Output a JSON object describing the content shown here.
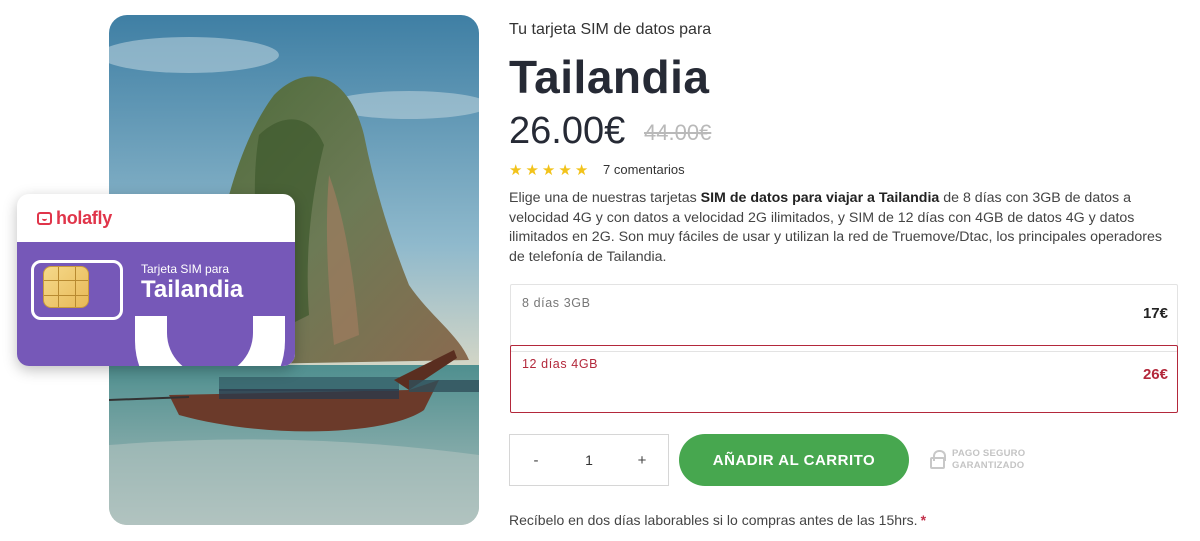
{
  "product": {
    "subtitle": "Tu tarjeta SIM de datos para",
    "title": "Tailandia",
    "price": "26.00€",
    "old_price": "44.00€",
    "rating": 5,
    "reviews": "7 comentarios",
    "description": {
      "p1": "Elige una de nuestras tarjetas ",
      "b1": "SIM de datos para viajar a Tailandia",
      "p2": " de 8 días con 3GB de datos a velocidad 4G y con datos a velocidad 2G ilimitados, y SIM de 12 días con 4GB de datos 4G y datos ilimitados en 2G. Son muy fáciles de usar y utilizan la red de Truemove/Dtac, los principales operadores de telefonía de Tailandia."
    }
  },
  "sim_card": {
    "brand": "holafly",
    "small_text": "Tarjeta SIM para",
    "big_text": "Tailandia"
  },
  "options": [
    {
      "label": "8 días 3GB",
      "price": "17€",
      "selected": false
    },
    {
      "label": "12 días 4GB",
      "price": "26€",
      "selected": true
    }
  ],
  "quantity": {
    "minus": "-",
    "value": "1",
    "plus": "+"
  },
  "cart_button": "AÑADIR AL CARRITO",
  "secure": {
    "line1": "PAGO SEGURO",
    "line2": "GARANTIZADO"
  },
  "delivery": {
    "text": "Recíbelo en dos días laborables si lo compras antes de las 15hrs.",
    "asterisk": "*"
  },
  "colors": {
    "accent": "#b3283b",
    "cart": "#47a74f",
    "star": "#f2c31b",
    "sim_purple": "#7658b8",
    "brand_red": "#e0354a"
  }
}
